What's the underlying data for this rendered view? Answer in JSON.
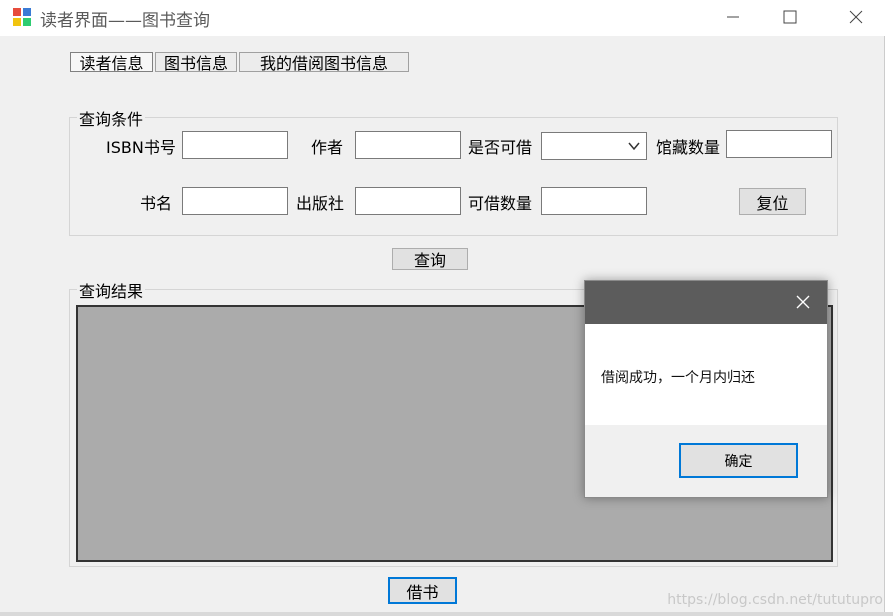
{
  "window": {
    "title": "读者界面——图书查询"
  },
  "tabs": [
    {
      "label": "读者信息"
    },
    {
      "label": "图书信息"
    },
    {
      "label": "我的借阅图书信息"
    }
  ],
  "query_group": {
    "label": "查询条件",
    "isbn_label": "ISBN书号",
    "author_label": "作者",
    "borrowable_label": "是否可借",
    "collection_count_label": "馆藏数量",
    "title_label": "书名",
    "publisher_label": "出版社",
    "available_count_label": "可借数量",
    "isbn_value": "",
    "author_value": "",
    "borrowable_value": "",
    "collection_count_value": "",
    "title_value": "",
    "publisher_value": "",
    "available_count_value": "",
    "reset_button": "复位"
  },
  "query_button": "查询",
  "results_group": {
    "label": "查询结果"
  },
  "borrow_button": "借书",
  "dialog": {
    "message": "借阅成功，一个月内归还",
    "ok_button": "确定"
  },
  "watermark": "https://blog.csdn.net/tututupro"
}
